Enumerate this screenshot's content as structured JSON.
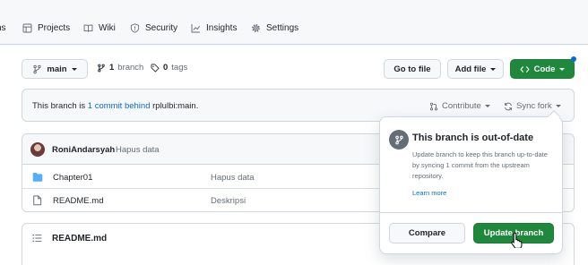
{
  "repo_nav": {
    "items": [
      {
        "label": "ns",
        "icon": "actions-icon"
      },
      {
        "label": "Projects",
        "icon": "table-icon"
      },
      {
        "label": "Wiki",
        "icon": "book-icon"
      },
      {
        "label": "Security",
        "icon": "shield-icon"
      },
      {
        "label": "Insights",
        "icon": "graph-icon"
      },
      {
        "label": "Settings",
        "icon": "gear-icon"
      }
    ]
  },
  "toolbar": {
    "branch_select": "main",
    "branch_count": "1",
    "branch_label": "branch",
    "tag_count": "0",
    "tag_label": "tags",
    "go_to_file": "Go to file",
    "add_file": "Add file",
    "code": "Code"
  },
  "branch_status": {
    "prefix": "This branch is ",
    "link": "1 commit behind",
    "suffix": " rplulbi:main.",
    "contribute": "Contribute",
    "sync_fork": "Sync fork"
  },
  "latest_commit": {
    "author": "RoniAndarsyah",
    "message": "Hapus data"
  },
  "files": [
    {
      "name": "Chapter01",
      "type": "folder",
      "message": "Hapus data"
    },
    {
      "name": "README.md",
      "type": "file",
      "message": "Deskripsi"
    }
  ],
  "readme": {
    "title": "README.md"
  },
  "popover": {
    "title": "This branch is out-of-date",
    "description": "Update branch to keep this branch up-to-date by syncing 1 commit from the upstream repository.",
    "learn_more": "Learn more",
    "compare": "Compare",
    "update_branch": "Update branch"
  },
  "colors": {
    "accent_green": "#1f883d",
    "link_blue": "#0969da",
    "folder_blue": "#54aeff"
  }
}
